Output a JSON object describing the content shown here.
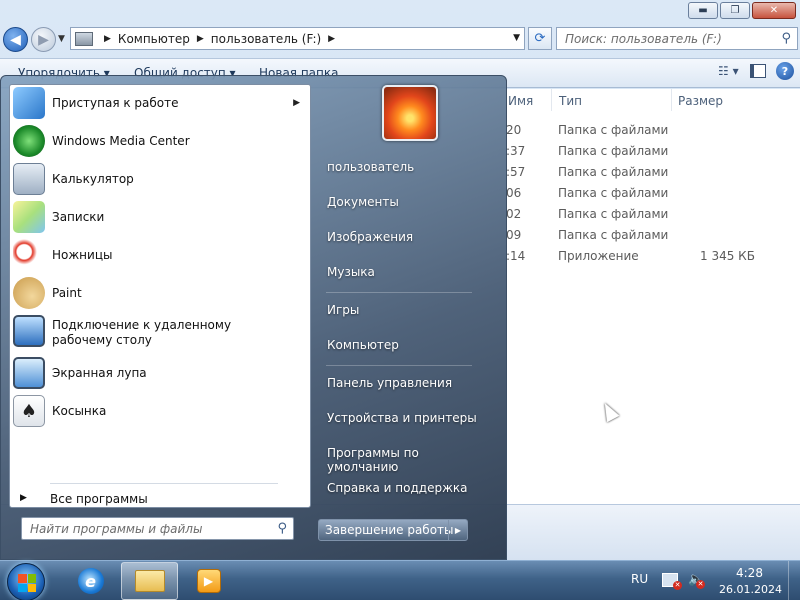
{
  "window": {
    "controls": {
      "minimize": "▬",
      "maximize": "❐",
      "close": "✕"
    }
  },
  "nav": {
    "breadcrumb": [
      "Компьютер",
      "пользователь (F:)"
    ],
    "search_placeholder": "Поиск: пользователь (F:)"
  },
  "toolbar": {
    "organize": "Упорядочить ▾",
    "share": "Общий доступ ▾",
    "new_folder": "Новая папка"
  },
  "columns": {
    "name": "Имя",
    "type": "Тип",
    "size": "Размер"
  },
  "files": [
    {
      "time": "20",
      "type": "Папка с файлами",
      "size": ""
    },
    {
      "time": ":37",
      "type": "Папка с файлами",
      "size": ""
    },
    {
      "time": ":57",
      "type": "Папка с файлами",
      "size": ""
    },
    {
      "time": "06",
      "type": "Папка с файлами",
      "size": ""
    },
    {
      "time": "02",
      "type": "Папка с файлами",
      "size": ""
    },
    {
      "time": "09",
      "type": "Папка с файлами",
      "size": ""
    },
    {
      "time": ":14",
      "type": "Приложение",
      "size": "1 345 КБ"
    }
  ],
  "start_menu": {
    "programs": [
      {
        "label": "Приступая к работе",
        "icon": "getting-started-icon",
        "submenu": true
      },
      {
        "label": "Windows Media Center",
        "icon": "media-center-icon",
        "submenu": false
      },
      {
        "label": "Калькулятор",
        "icon": "calculator-icon",
        "submenu": false
      },
      {
        "label": "Записки",
        "icon": "sticky-notes-icon",
        "submenu": false
      },
      {
        "label": "Ножницы",
        "icon": "snipping-tool-icon",
        "submenu": false
      },
      {
        "label": "Paint",
        "icon": "paint-icon",
        "submenu": false
      },
      {
        "label": "Подключение к удаленному рабочему столу",
        "icon": "remote-desktop-icon",
        "submenu": false
      },
      {
        "label": "Экранная лупа",
        "icon": "magnifier-icon",
        "submenu": false
      },
      {
        "label": "Косынка",
        "icon": "solitaire-icon",
        "submenu": false
      }
    ],
    "all_programs": "Все программы",
    "search_placeholder": "Найти программы и файлы",
    "right": [
      "пользователь",
      "Документы",
      "Изображения",
      "Музыка",
      "Игры",
      "Компьютер",
      "Панель управления",
      "Устройства и принтеры",
      "Программы по умолчанию",
      "Справка и поддержка"
    ],
    "shutdown": "Завершение работы"
  },
  "taskbar": {
    "language": "RU",
    "time": "4:28",
    "date": "26.01.2024"
  },
  "colors": {
    "accent": "#1f5fb8",
    "start_menu_right": "#46607d",
    "taskbar": "#3f6288"
  }
}
